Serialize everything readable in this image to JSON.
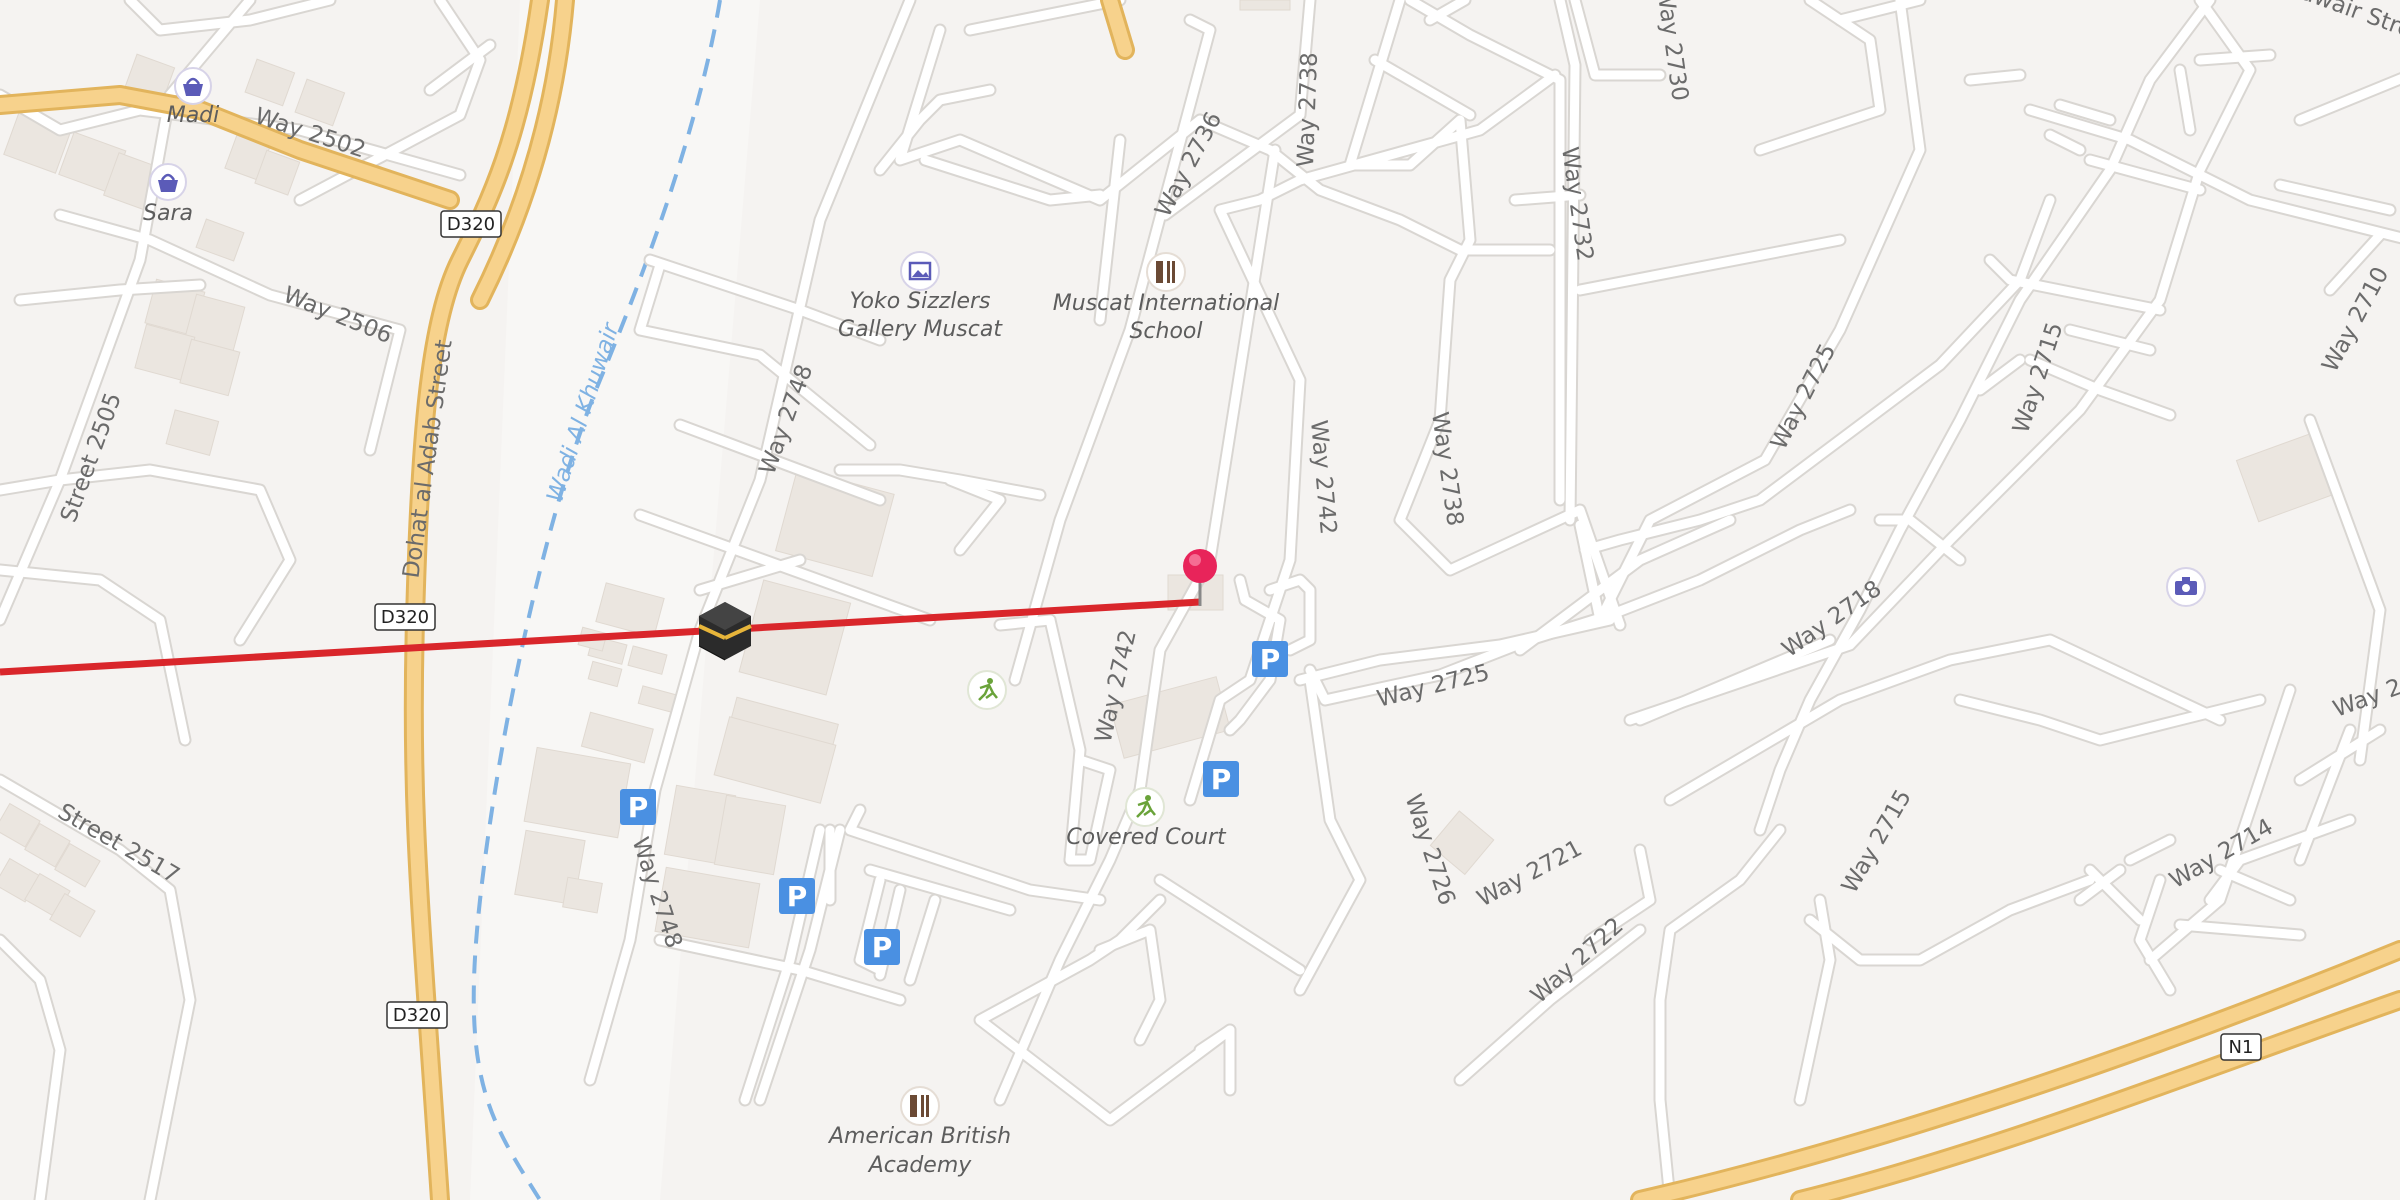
{
  "map": {
    "road_labels": [
      {
        "id": "way-2502",
        "text": "Way 2502"
      },
      {
        "id": "way-2506",
        "text": "Way 2506"
      },
      {
        "id": "street-2505",
        "text": "Street 2505"
      },
      {
        "id": "dohat-al-adab-street",
        "text": "Dohat al Adab Street"
      },
      {
        "id": "street-2517",
        "text": "Street 2517"
      },
      {
        "id": "way-2748-a",
        "text": "Way 2748"
      },
      {
        "id": "way-2748-b",
        "text": "Way 2748"
      },
      {
        "id": "way-2742-a",
        "text": "Way 2742"
      },
      {
        "id": "way-2742-b",
        "text": "Way 2742"
      },
      {
        "id": "way-2736",
        "text": "Way 2736"
      },
      {
        "id": "way-2738-a",
        "text": "Way 2738"
      },
      {
        "id": "way-2738-b",
        "text": "Way 2738"
      },
      {
        "id": "way-2730",
        "text": "Way 2730"
      },
      {
        "id": "way-2732",
        "text": "Way 2732"
      },
      {
        "id": "way-2725-a",
        "text": "Way 2725"
      },
      {
        "id": "way-2725-b",
        "text": "Way 2725"
      },
      {
        "id": "way-2715-a",
        "text": "Way 2715"
      },
      {
        "id": "way-2715-b",
        "text": "Way 2715"
      },
      {
        "id": "way-2718",
        "text": "Way 2718"
      },
      {
        "id": "way-2710",
        "text": "Way 2710"
      },
      {
        "id": "way-2726",
        "text": "Way 2726"
      },
      {
        "id": "way-2721",
        "text": "Way 2721"
      },
      {
        "id": "way-2722",
        "text": "Way 2722"
      },
      {
        "id": "way-2714",
        "text": "Way 2714"
      },
      {
        "id": "way-2-partial",
        "text": "Way 2"
      },
      {
        "id": "wavir-street-partial",
        "text": "awair Street"
      }
    ],
    "water_labels": [
      {
        "id": "wadi-al-khuwair",
        "text": "Wadi Al Khuwair"
      }
    ],
    "shields": [
      {
        "id": "d320-a",
        "text": "D320"
      },
      {
        "id": "d320-b",
        "text": "D320"
      },
      {
        "id": "d320-c",
        "text": "D320"
      },
      {
        "id": "n1",
        "text": "N1"
      }
    ],
    "pois": [
      {
        "id": "madi",
        "text": "Madi",
        "icon": "shopping-basket-icon"
      },
      {
        "id": "sara",
        "text": "Sara",
        "icon": "shopping-basket-icon"
      },
      {
        "id": "yoko-line1",
        "text": "Yoko Sizzlers"
      },
      {
        "id": "yoko-line2",
        "text": "Gallery Muscat"
      },
      {
        "id": "mis-line1",
        "text": "Muscat International"
      },
      {
        "id": "mis-line2",
        "text": "School"
      },
      {
        "id": "covered-court",
        "text": "Covered Court"
      },
      {
        "id": "aba-line1",
        "text": "American British"
      },
      {
        "id": "aba-line2",
        "text": "Academy"
      }
    ],
    "parking_label": "P",
    "colors": {
      "background": "#f5f3f1",
      "road": "#ffffff",
      "road_casing": "#d9d6d2",
      "motorway": "#f7d28c",
      "motorway_casing": "#e2b45c",
      "water": "#7fb2e3",
      "building": "#ebe6e0",
      "qibla_line": "#d9262b",
      "pin": "#e8245a",
      "parking": "#4a90e2"
    }
  }
}
